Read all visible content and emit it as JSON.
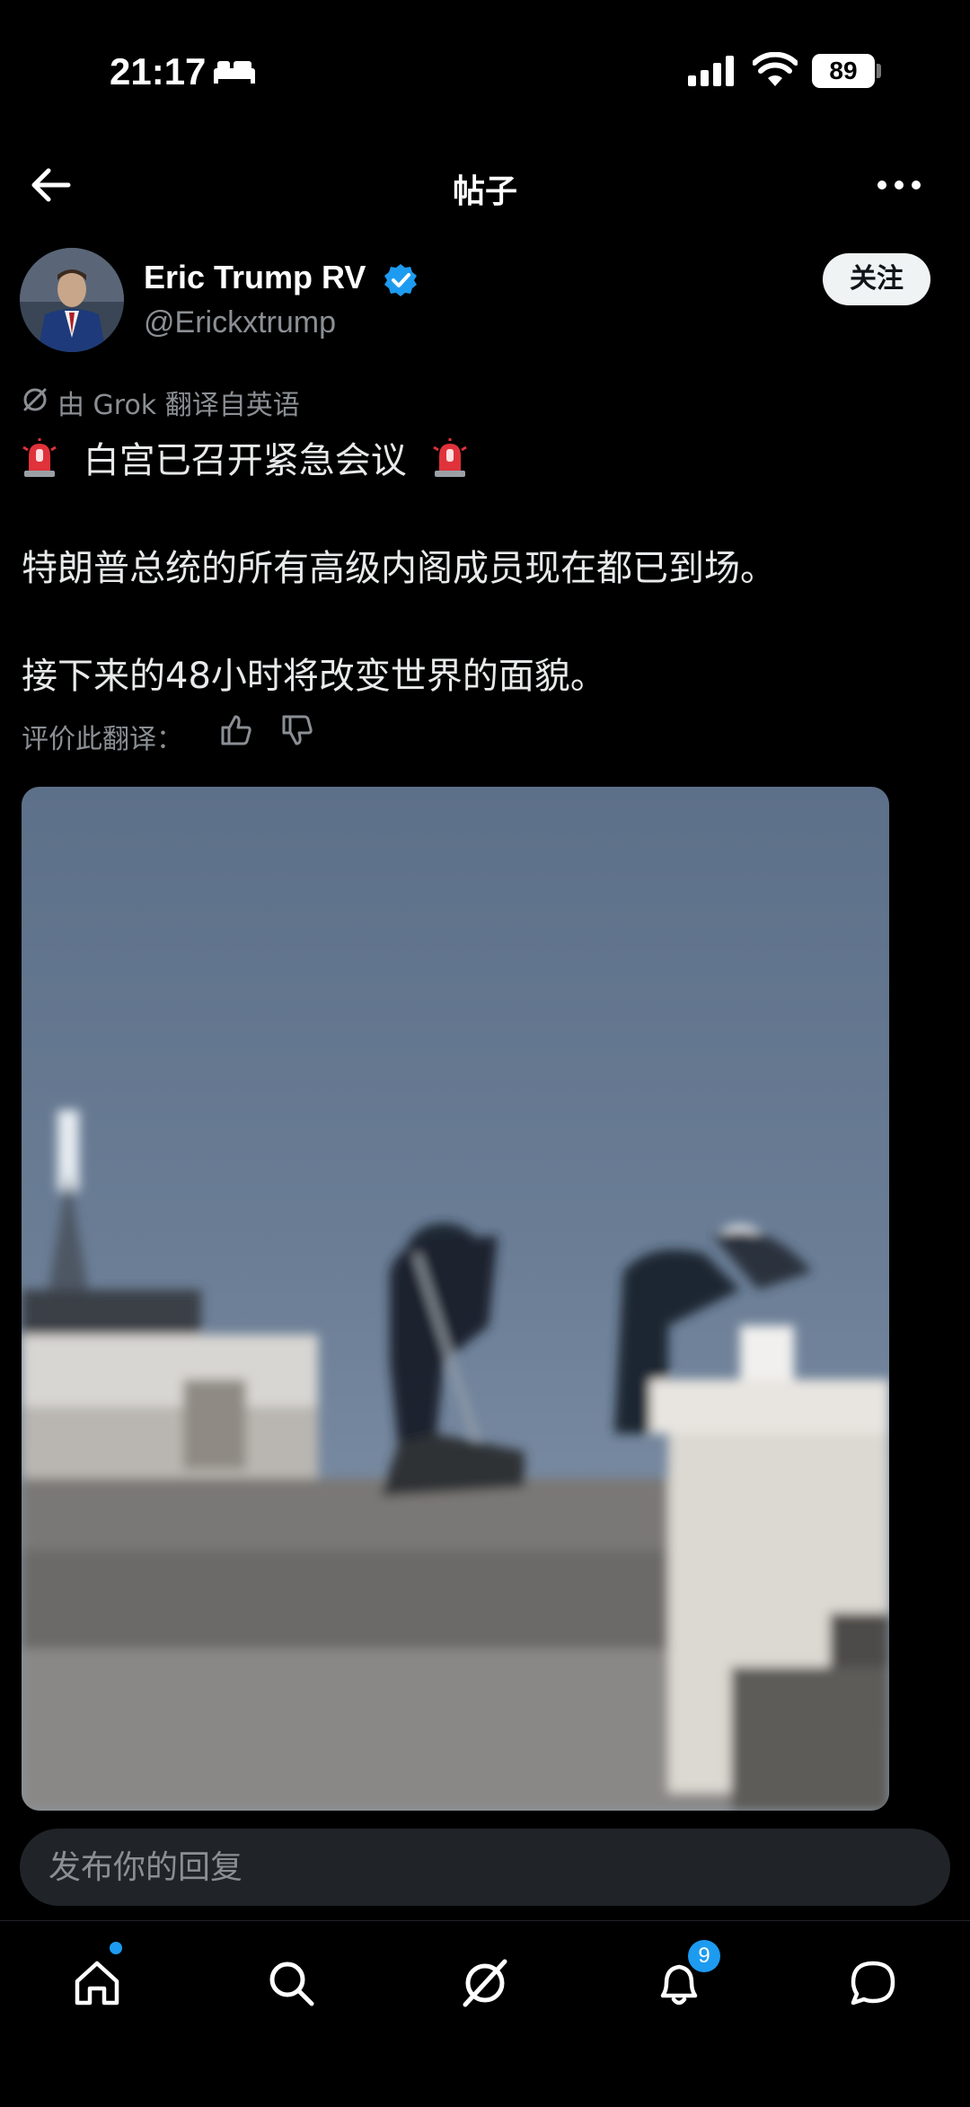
{
  "status": {
    "time": "21:17",
    "battery": "89"
  },
  "header": {
    "title": "帖子"
  },
  "author": {
    "name": "Eric Trump RV",
    "handle": "@Erickxtrump",
    "follow_label": "关注"
  },
  "translation": {
    "note": "由 Grok 翻译自英语",
    "rate_label": "评价此翻译："
  },
  "post": {
    "headline": "白宫已召开紧急会议",
    "line1": "特朗普总统的所有高级内阁成员现在都已到场。",
    "line2": "接下来的48小时将改变世界的面貌。"
  },
  "reply": {
    "placeholder": "发布你的回复"
  },
  "nav": {
    "notifications_count": "9"
  },
  "colors": {
    "accent": "#1d9bf0",
    "background": "#000000",
    "secondary_text": "#8b8f94"
  }
}
